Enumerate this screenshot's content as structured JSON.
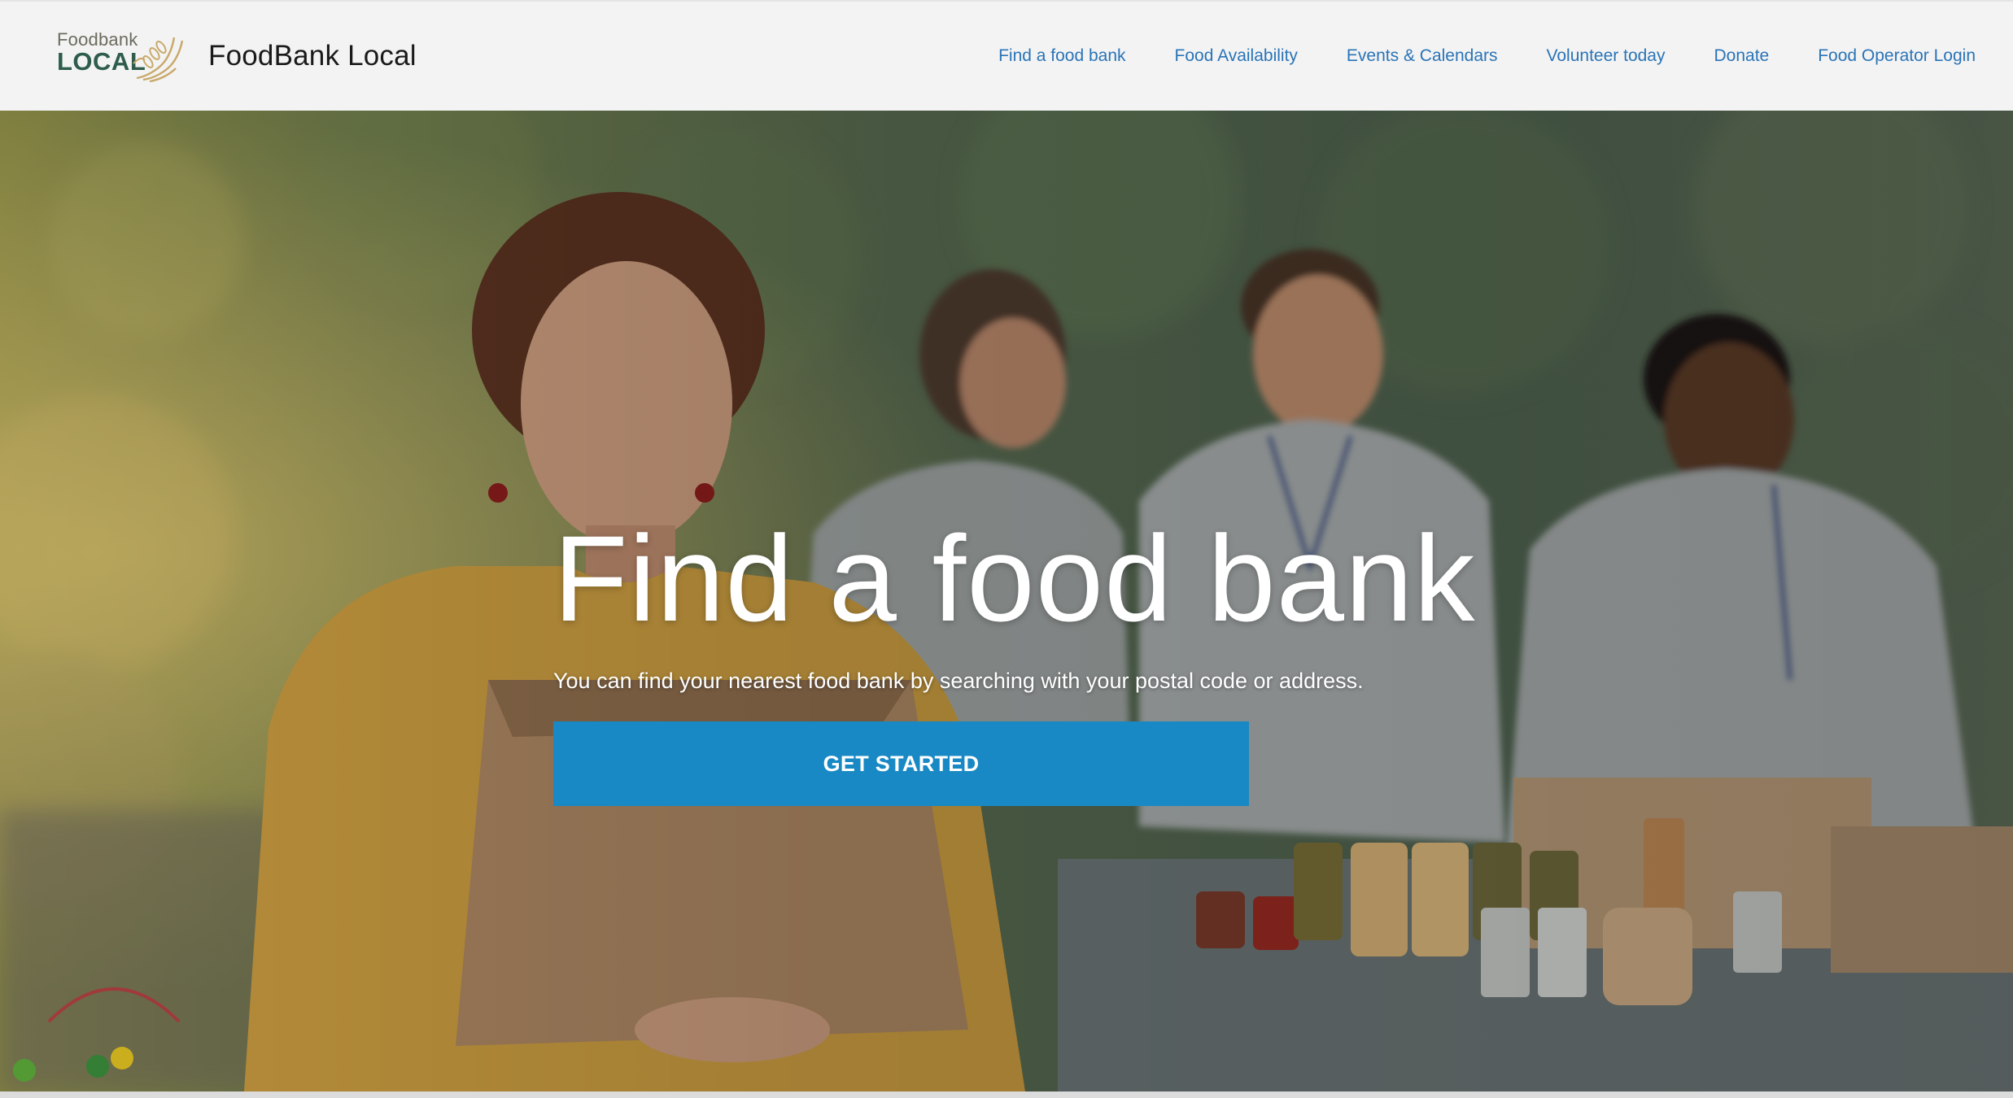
{
  "header": {
    "logo": {
      "line1": "Foodbank",
      "line2": "LOCAL",
      "icon": "hands-wheat-icon"
    },
    "site_title": "FoodBank Local",
    "nav": [
      {
        "label": "Find a food bank"
      },
      {
        "label": "Food Availability"
      },
      {
        "label": "Events & Calendars"
      },
      {
        "label": "Volunteer today"
      },
      {
        "label": "Donate"
      },
      {
        "label": "Food Operator Login"
      }
    ]
  },
  "hero": {
    "title": "Find a food bank",
    "subtitle": "You can find your nearest food bank by searching with your postal code or address.",
    "cta_label": "GET STARTED",
    "background": "volunteers-at-food-bank-photo"
  },
  "colors": {
    "nav_link": "#2a74b7",
    "cta": "#1889c4",
    "header_bg": "#f3f3f3",
    "logo_green": "#2e5d4c",
    "logo_gold": "#c9a96a"
  }
}
